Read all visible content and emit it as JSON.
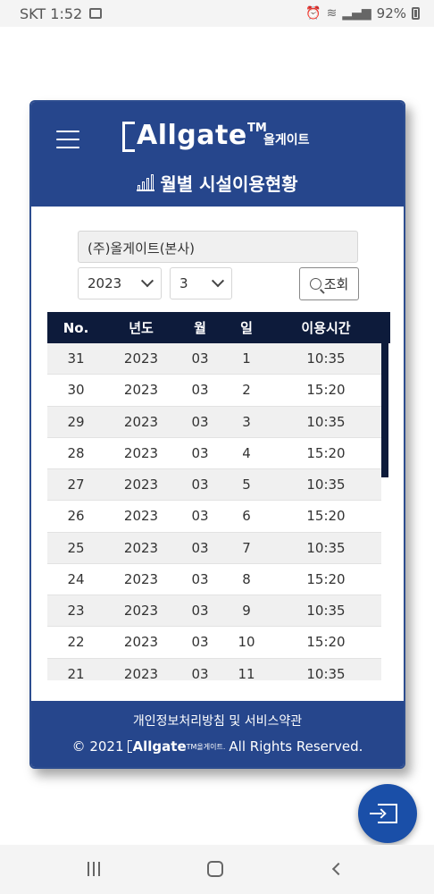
{
  "status_bar": {
    "carrier_time": "SKT 1:52",
    "battery": "92%"
  },
  "header": {
    "logo_text": "Allgate",
    "logo_tm": "TM",
    "logo_kr": "올게이트",
    "title": "월별 시설이용현황"
  },
  "filters": {
    "site": "(주)올게이트(본사)",
    "year": "2023",
    "month": "3",
    "search_label": "조회"
  },
  "table": {
    "columns": [
      "No.",
      "년도",
      "월",
      "일",
      "이용시간"
    ],
    "rows": [
      [
        "31",
        "2023",
        "03",
        "1",
        "10:35"
      ],
      [
        "30",
        "2023",
        "03",
        "2",
        "15:20"
      ],
      [
        "29",
        "2023",
        "03",
        "3",
        "10:35"
      ],
      [
        "28",
        "2023",
        "03",
        "4",
        "15:20"
      ],
      [
        "27",
        "2023",
        "03",
        "5",
        "10:35"
      ],
      [
        "26",
        "2023",
        "03",
        "6",
        "15:20"
      ],
      [
        "25",
        "2023",
        "03",
        "7",
        "10:35"
      ],
      [
        "24",
        "2023",
        "03",
        "8",
        "15:20"
      ],
      [
        "23",
        "2023",
        "03",
        "9",
        "10:35"
      ],
      [
        "22",
        "2023",
        "03",
        "10",
        "15:20"
      ],
      [
        "21",
        "2023",
        "03",
        "11",
        "10:35"
      ]
    ]
  },
  "footer": {
    "link": "개인정보처리방침 및 서비스약관",
    "copy_prefix": "© 2021",
    "copy_logo": "Allgate",
    "copy_logo_small": "TM올게이트.",
    "copy_suffix": "All Rights Reserved."
  },
  "icons": {
    "menu": "hamburger-icon",
    "chart": "bar-chart-icon",
    "search": "search-icon",
    "exit": "exit-icon"
  },
  "colors": {
    "primary": "#26468c",
    "table_header": "#0d1b3b",
    "fab": "#1a4fa8"
  }
}
